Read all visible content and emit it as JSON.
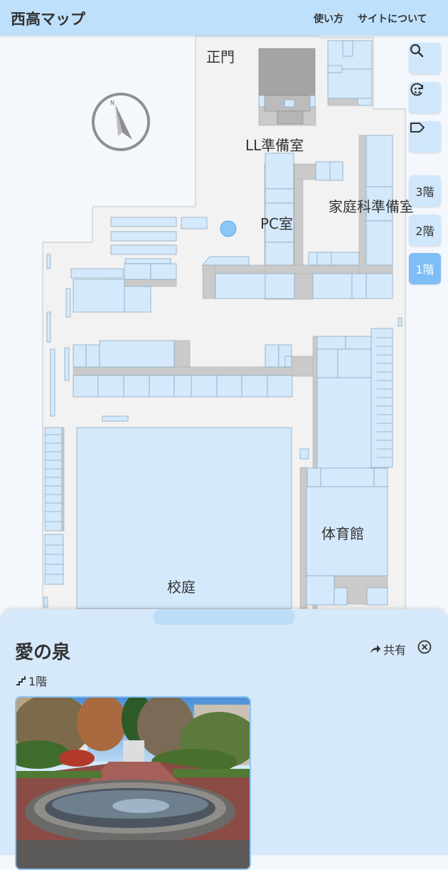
{
  "header": {
    "title": "西高マップ",
    "links": [
      "使い方",
      "サイトについて"
    ]
  },
  "map": {
    "labels": {
      "main_gate": "正門",
      "ll_prep": "LL準備室",
      "pc_room": "PC室",
      "home_ec_prep": "家庭科準備室",
      "gym": "体育館",
      "courtyard": "校庭"
    },
    "compass_letter": "N"
  },
  "controls": {
    "search": "search-icon",
    "locate": "locate-icon",
    "labels": "tag-icon"
  },
  "floors": [
    "3階",
    "2階",
    "1階"
  ],
  "selected_floor": "1階",
  "panel": {
    "name": "愛の泉",
    "share_label": "共有",
    "floor": "1階"
  },
  "colors": {
    "header": "#bfe0fb",
    "room": "#d4e9fb",
    "corridor": "#cacaca",
    "active_floor": "#7fbdf6",
    "location_dot": "#8cc6f7"
  }
}
